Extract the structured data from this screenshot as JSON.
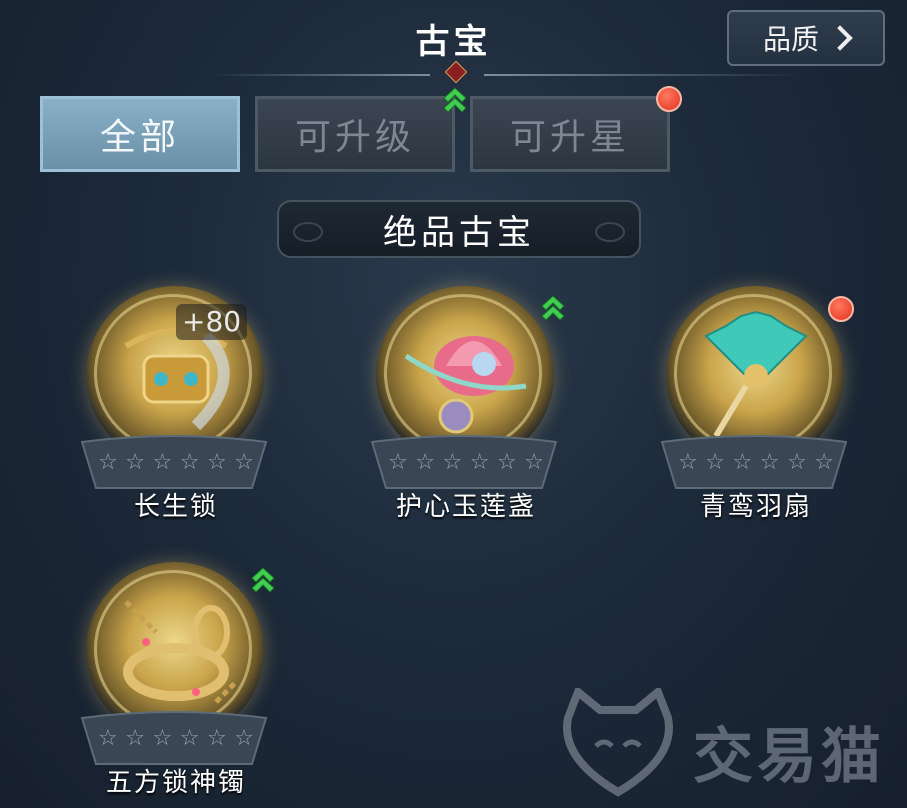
{
  "header": {
    "title": "古宝",
    "quality_button": "品质"
  },
  "tabs": [
    {
      "label": "全部",
      "active": true
    },
    {
      "label": "可升级",
      "active": false,
      "badge": "green-upgrade-arrow"
    },
    {
      "label": "可升星",
      "active": false,
      "badge": "red-dot"
    }
  ],
  "section": {
    "title": "绝品古宝"
  },
  "items": [
    {
      "name": "长生锁",
      "plus": "+80",
      "stars": 6,
      "filled_stars": 0,
      "badge": ""
    },
    {
      "name": "护心玉莲盏",
      "plus": "",
      "stars": 6,
      "filled_stars": 0,
      "badge": "green-upgrade-arrow"
    },
    {
      "name": "青鸾羽扇",
      "plus": "",
      "stars": 6,
      "filled_stars": 0,
      "badge": "red-dot"
    },
    {
      "name": "五方锁神镯",
      "plus": "",
      "stars": 6,
      "filled_stars": 0,
      "badge": "green-upgrade-arrow"
    }
  ],
  "watermark": {
    "text": "交易猫"
  },
  "colors": {
    "active_tab": "#7aa2ba",
    "red_dot": "#e1301c",
    "green_arrow": "#3fcf4f",
    "gold": "#c9a44a"
  }
}
